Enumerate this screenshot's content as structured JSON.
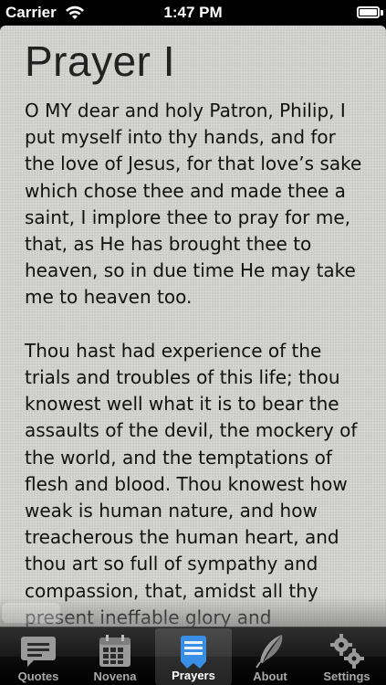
{
  "status_bar": {
    "carrier": "Carrier",
    "time": "1:47 PM",
    "battery_level": 1.0
  },
  "page": {
    "title": "Prayer I",
    "paragraphs": [
      "O MY dear and holy Patron, Philip, I put myself into thy hands, and for the love of Jesus, for that love’s sake which chose thee and made thee a saint, I implore thee to pray for me, that, as He has brought thee to heaven, so in due time He may take me to heaven too.",
      "Thou hast had experience of the trials and troubles of this life; thou knowest well what it is to bear the assaults of the devil, the mockery of the world, and the temptations of flesh and blood. Thou knowest how weak is human nature, and how treacherous the human heart, and thou art so full of sympathy and compassion, that, amidst all thy present ineffable glory and"
    ]
  },
  "tab_bar": {
    "tabs": [
      {
        "label": "Quotes",
        "icon": "speech-bubble-icon"
      },
      {
        "label": "Novena",
        "icon": "calendar-icon"
      },
      {
        "label": "Prayers",
        "icon": "prayer-book-icon",
        "selected": true
      },
      {
        "label": "About",
        "icon": "quill-feather-icon"
      },
      {
        "label": "Settings",
        "icon": "gears-icon"
      }
    ]
  },
  "colors": {
    "background": "#d3d3d1",
    "text": "#111111",
    "tab_selected_icon": "#3a8ee6",
    "tab_icon": "#a9a9a9"
  }
}
